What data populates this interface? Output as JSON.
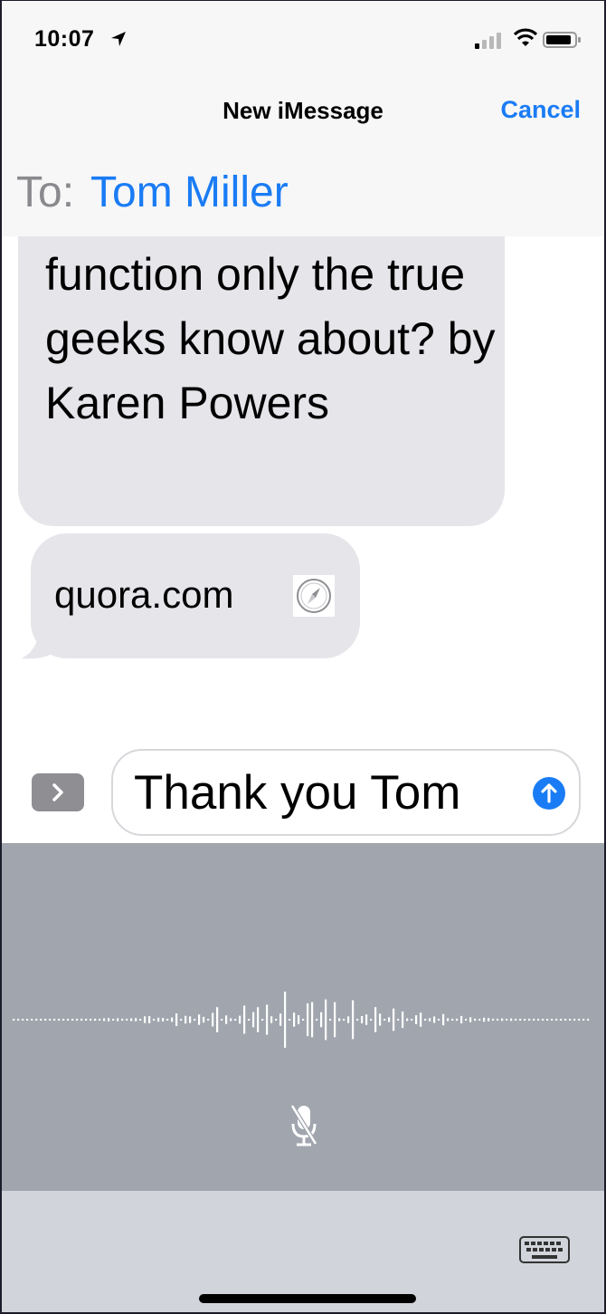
{
  "status_bar": {
    "time": "10:07",
    "icons": [
      "location-arrow-icon",
      "signal-icon",
      "wifi-icon",
      "battery-icon"
    ]
  },
  "nav": {
    "title": "New iMessage",
    "cancel_label": "Cancel"
  },
  "to": {
    "label": "To:",
    "recipient": "Tom Miller"
  },
  "messages": {
    "received_text": "coolest iPhone function only the true geeks know about? by Karen Powers",
    "link_text": "quora.com"
  },
  "compose": {
    "input_value": "Thank you Tom",
    "apps_icon": "chevron-right-icon",
    "send_icon": "arrow-up-icon"
  },
  "dictation": {
    "icons": [
      "waveform-icon",
      "microphone-off-icon"
    ]
  },
  "bottom": {
    "icons": [
      "keyboard-icon"
    ]
  },
  "colors": {
    "accent": "#1a7cf5",
    "bubble": "#e5e5ea",
    "dictation_bg": "#a1a6ae",
    "bottom_bg": "#d1d4da"
  }
}
